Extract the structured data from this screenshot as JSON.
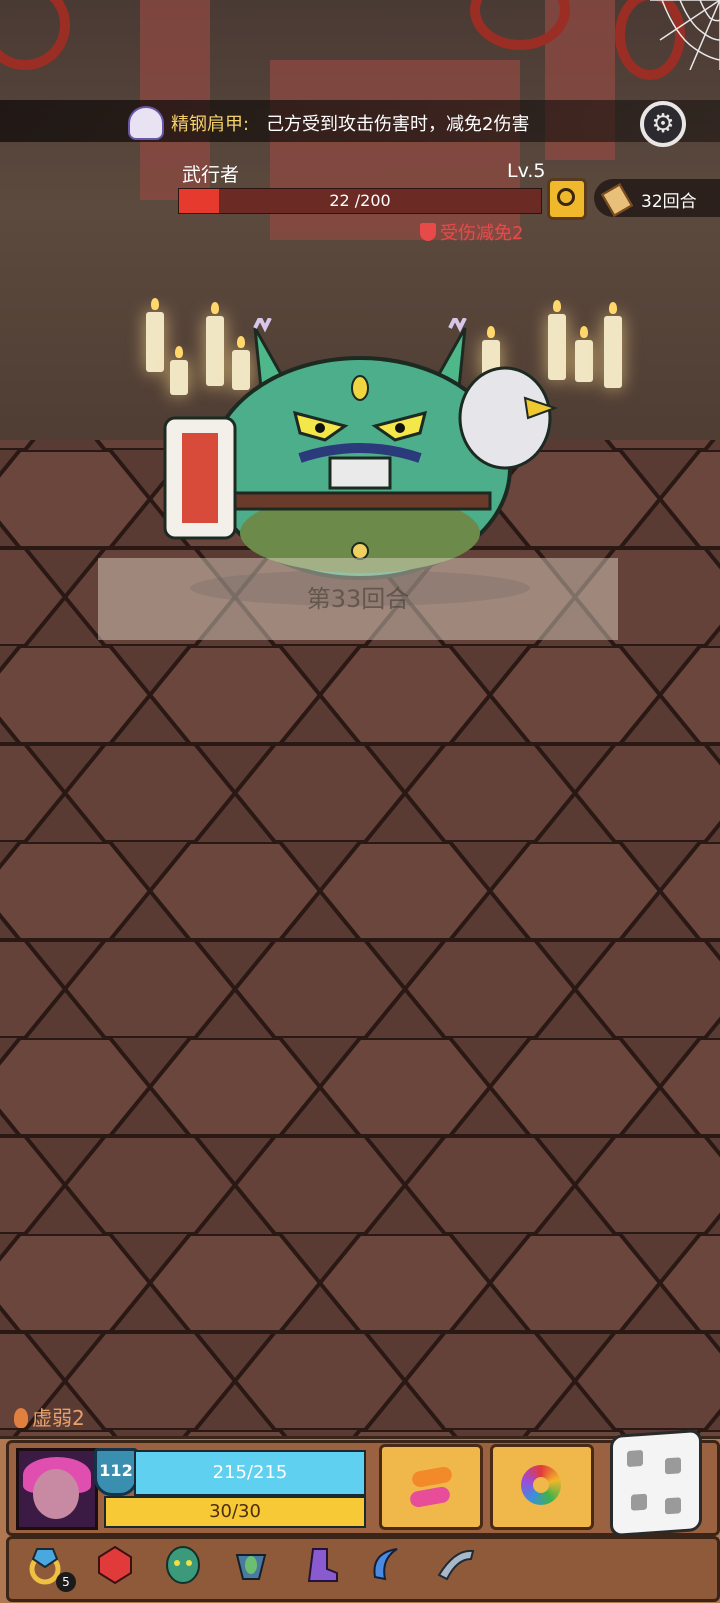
{
  "buff": {
    "icon": "claw-armor-icon",
    "name": "精钢肩甲:",
    "description": "己方受到攻击伤害时，减免2伤害"
  },
  "enemy": {
    "name": "武行者",
    "level": "Lv.5",
    "hp_text": "22 /200",
    "hp_current": 22,
    "hp_max": 200,
    "status": "受伤减免2"
  },
  "round": {
    "count_label": "32回合",
    "banner": "第33回合"
  },
  "player": {
    "status": "虚弱2",
    "level": "112",
    "shield_text": "215/215",
    "energy_text": "30/30"
  },
  "actions": {
    "swap": "swap-icon",
    "swirl": "swirl-icon",
    "dice": "dice-icon"
  },
  "relics": [
    {
      "name": "blue-ring-icon",
      "badge": "5"
    },
    {
      "name": "ruby-gem-icon"
    },
    {
      "name": "jade-mask-icon"
    },
    {
      "name": "leaf-cup-icon"
    },
    {
      "name": "purple-boot-icon"
    },
    {
      "name": "blue-sickle-icon"
    },
    {
      "name": "spiked-horn-icon"
    }
  ],
  "colors": {
    "hp_fill": "#e73a2e",
    "shield_bar": "#5fd0f0",
    "energy_bar": "#f7c936",
    "buff_name": "#f2d16a",
    "status_red": "#e84a4a"
  }
}
